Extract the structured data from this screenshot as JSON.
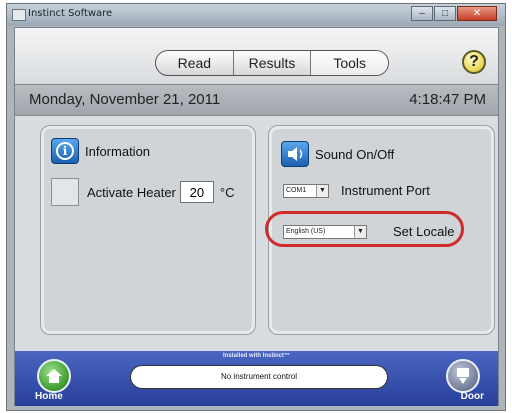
{
  "window": {
    "title": "Instinct Software"
  },
  "tabs": [
    {
      "label": "Read",
      "active": false
    },
    {
      "label": "Results",
      "active": false
    },
    {
      "label": "Tools",
      "active": true
    }
  ],
  "help": {
    "label": "?"
  },
  "datebar": {
    "date": "Monday, November 21, 2011",
    "time": "4:18:47 PM"
  },
  "left_panel": {
    "information_label": "Information",
    "info_icon_glyph": "i",
    "heater_label": "Activate Heater",
    "heater_value": "20",
    "heater_unit": "°C"
  },
  "right_panel": {
    "sound_label": "Sound On/Off",
    "port_value": "COM1",
    "port_label": "Instrument Port",
    "locale_value": "English (US)",
    "locale_label": "Set Locale"
  },
  "bottombar": {
    "installed_text": "Installed with Instinct™",
    "status_text": "No instrument control",
    "home_label": "Home",
    "door_label": "Door"
  },
  "colors": {
    "highlight": "#d12a2a",
    "bottombar": "#3a55b0",
    "accent_blue": "#2a74cc"
  }
}
